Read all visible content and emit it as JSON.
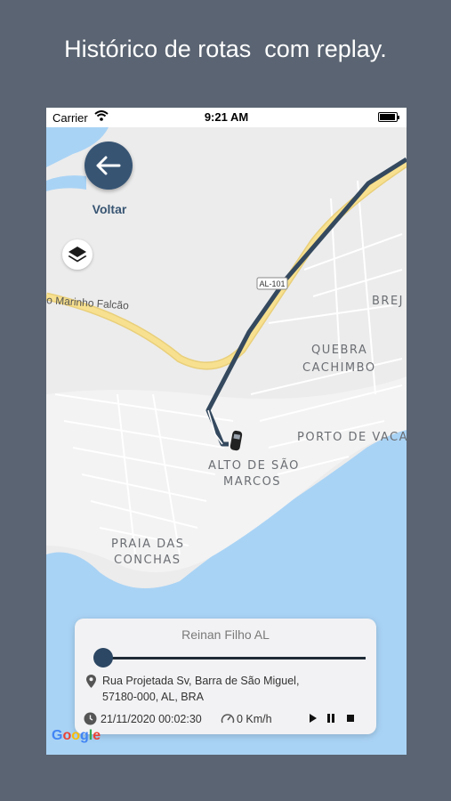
{
  "headline": "Histórico de rotas  com replay.",
  "status_bar": {
    "carrier": "Carrier",
    "time": "9:21 AM"
  },
  "map": {
    "back_label": "Voltar",
    "road_badge": "AL-101",
    "street_label": "o Marinho Falcão",
    "places": {
      "brejo": "BREJ",
      "quebra_1": "QUEBRA",
      "quebra_2": "CACHIMBO",
      "porto": "PORTO DE VACA",
      "alto_1": "ALTO DE SÃO",
      "alto_2": "MARCOS",
      "praia_1": "PRAIA DAS",
      "praia_2": "CONCHAS"
    },
    "attribution": "Google",
    "colors": {
      "route": "#34495e",
      "water": "#a9d3f5",
      "highway": "#f7e08f"
    }
  },
  "replay_card": {
    "driver_name": "Reinan Filho AL",
    "progress": 0.0,
    "address_line1": "Rua Projetada Sv, Barra de São Miguel,",
    "address_line2": "57180-000, AL, BRA",
    "datetime": "21/11/2020 00:02:30",
    "speed": "0 Km/h",
    "controls": [
      "play-icon",
      "pause-icon",
      "stop-icon"
    ]
  }
}
